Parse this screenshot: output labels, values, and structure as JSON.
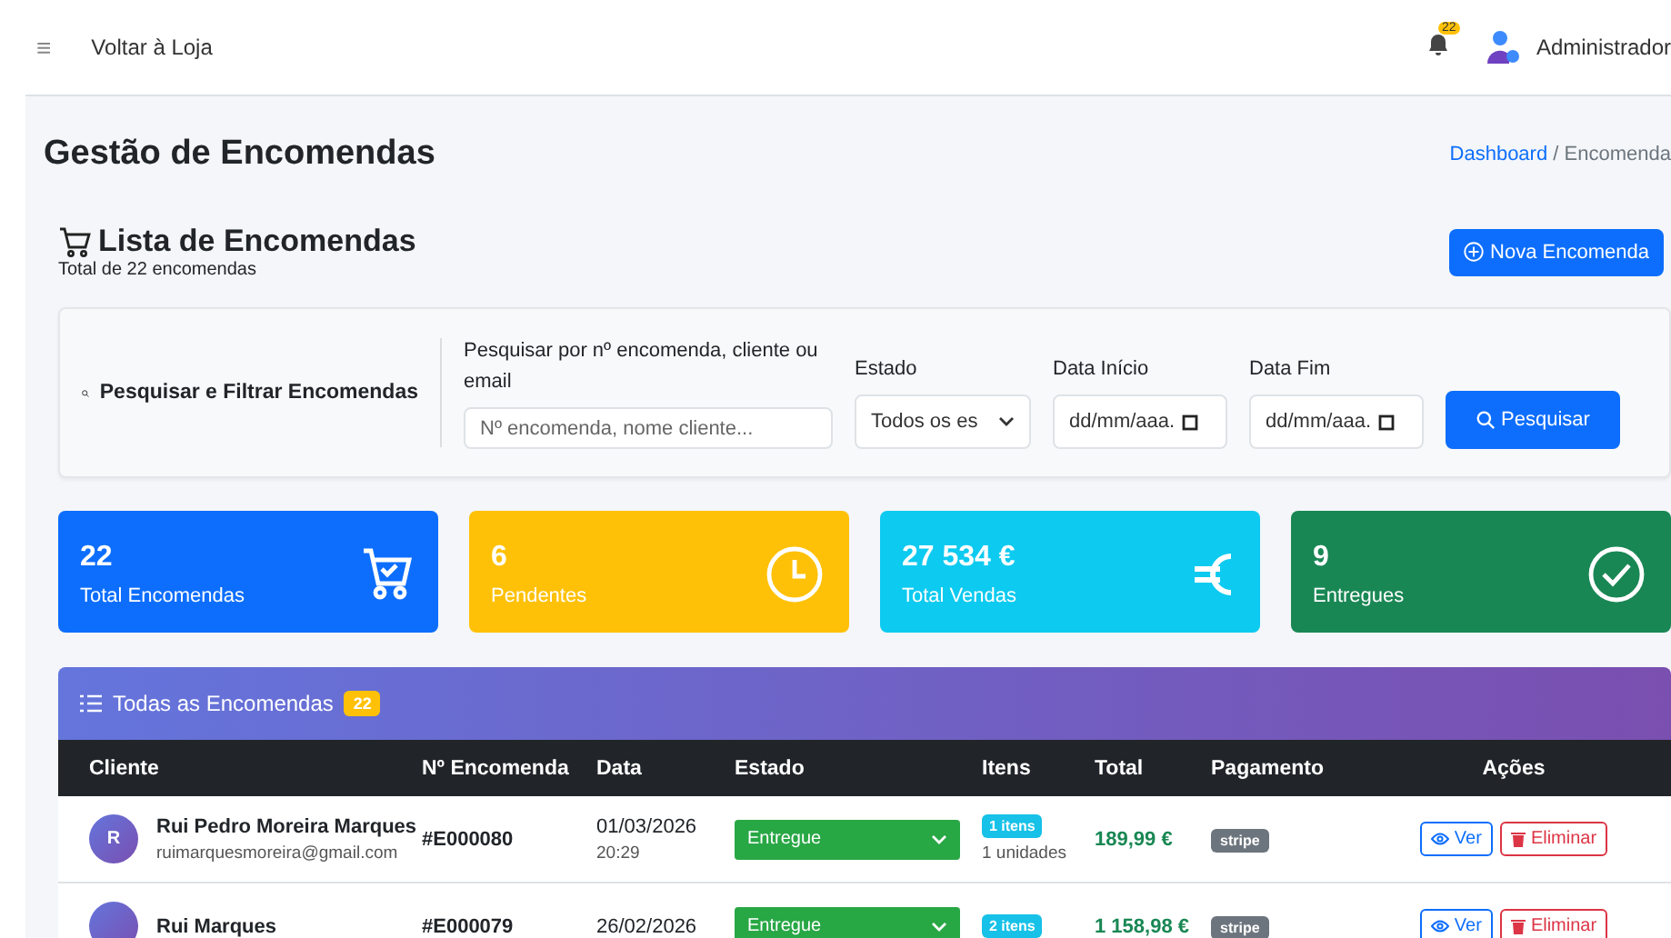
{
  "topbar": {
    "menu_icon": "≡",
    "link": "Voltar à Loja",
    "notifications": "22",
    "user": "Administrador"
  },
  "page": {
    "title": "Gestão de Encomendas",
    "breadcrumb_separator": "/",
    "breadcrumb": [
      {
        "label": "Dashboard",
        "link": true
      },
      {
        "label": "Encomenda",
        "link": false
      }
    ]
  },
  "list_header": {
    "title": "Lista de Encomendas",
    "subtitle": "Total de 22 encomendas",
    "button": "Nova Encomenda"
  },
  "filters": {
    "title": "Pesquisar e Filtrar Encomendas",
    "search": {
      "label": "Pesquisar por nº encomenda, cliente ou email",
      "placeholder": "Nº encomenda, nome cliente..."
    },
    "status": {
      "label": "Estado",
      "value": "Todos os es"
    },
    "date_from": {
      "label": "Data Início",
      "placeholder": "dd/mm/aaa."
    },
    "date_to": {
      "label": "Data Fim",
      "placeholder": "dd/mm/aaa."
    },
    "button": "Pesquisar"
  },
  "stats": [
    {
      "kind": "cart",
      "value": "22",
      "label": "Total Encomendas",
      "color": "#0d6efd"
    },
    {
      "kind": "clock",
      "value": "6",
      "label": "Pendentes",
      "color": "#ffc107"
    },
    {
      "kind": "euro",
      "value": "27 534 €",
      "label": "Total Vendas",
      "color": "#0dcaf0"
    },
    {
      "kind": "check",
      "value": "9",
      "label": "Entregues",
      "color": "#198754"
    }
  ],
  "table": {
    "title": "Todas as Encomendas",
    "count": "22",
    "columns": [
      "Cliente",
      "Nº Encomenda",
      "Data",
      "Estado",
      "Itens",
      "Total",
      "Pagamento",
      "Ações"
    ],
    "rows": [
      {
        "avatar": "R",
        "name": "Rui Pedro Moreira Marques",
        "email": "ruimarquesmoreira@gmail.com",
        "number": "#E000080",
        "date": "01/03/2026",
        "time": "20:29",
        "status": "Entregue",
        "items": "1 itens",
        "units": "1 unidades",
        "total": "189,99 €",
        "payment": "stripe",
        "view": "Ver",
        "delete": "Eliminar"
      },
      {
        "name": "Rui Marques",
        "number": "#E000079",
        "date": "26/02/2026",
        "status": "Entregue",
        "items": "2 itens",
        "total": "1 158,98 €",
        "payment": "stripe",
        "view": "Ver",
        "delete": "Eliminar"
      }
    ]
  }
}
